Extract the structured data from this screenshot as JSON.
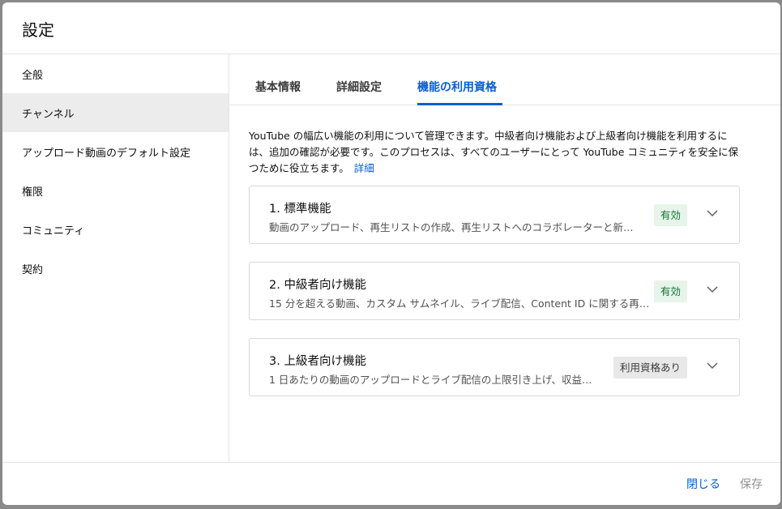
{
  "dialog": {
    "title": "設定"
  },
  "sidebar": {
    "items": [
      {
        "label": "全般"
      },
      {
        "label": "チャンネル"
      },
      {
        "label": "アップロード動画のデフォルト設定"
      },
      {
        "label": "権限"
      },
      {
        "label": "コミュニティ"
      },
      {
        "label": "契約"
      }
    ],
    "active": "チャンネル"
  },
  "tabs": [
    {
      "label": "基本情報"
    },
    {
      "label": "詳細設定"
    },
    {
      "label": "機能の利用資格"
    }
  ],
  "active_tab": "機能の利用資格",
  "description": {
    "text": "YouTube の幅広い機能の利用について管理できます。中級者向け機能および上級者向け機能を利用するには、追加の確認が必要です。このプロセスは、すべてのユーザーにとって YouTube コミュニティを安全に保つために役立ちます。",
    "link": "詳細"
  },
  "cards": [
    {
      "title": "1. 標準機能",
      "desc": "動画のアップロード、再生リストの作成、再生リストへのコラボレーターと新…",
      "badge": "有効",
      "status_color": "#137333"
    },
    {
      "title": "2. 中級者向け機能",
      "desc": "15 分を超える動画、カスタム サムネイル、ライブ配信、Content ID に関する再…",
      "badge": "有効",
      "status_color": "#137333"
    },
    {
      "title": "3. 上級者向け機能",
      "desc": "1 日あたりの動画のアップロードとライブ配信の上限引き上げ、収益…",
      "badge": "利用資格あり",
      "status_color": "#3b3b3b"
    }
  ],
  "footer": {
    "close_label": "閉じる",
    "save_label": "保存"
  },
  "icons": {
    "expand": "chevron-down-icon"
  },
  "colors": {
    "accent": "#065fd4",
    "enabled_bg": "#e6f4ea",
    "neutral_bg": "#e8e8e8"
  }
}
